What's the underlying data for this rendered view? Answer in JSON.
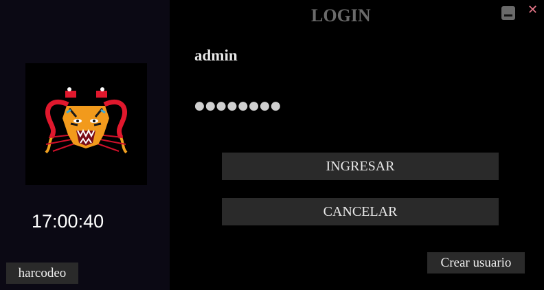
{
  "window": {
    "title": "LOGIN",
    "minimize_icon": "minimize-icon",
    "close_icon": "close-icon",
    "close_glyph": "✕",
    "close_color": "#e8788a"
  },
  "sidebar": {
    "logo_icon": "tiger-logo-icon",
    "clock": "17:00:40",
    "harcodeo_label": "harcodeo"
  },
  "form": {
    "username_value": "admin",
    "password_mask": "●●●●●●●●",
    "login_label": "INGRESAR",
    "cancel_label": "CANCELAR",
    "create_user_label": "Crear usuario"
  },
  "colors": {
    "background": "#000000",
    "sidebar": "#0b0914",
    "button": "#2a2a2a",
    "title": "#6b6b6b"
  }
}
